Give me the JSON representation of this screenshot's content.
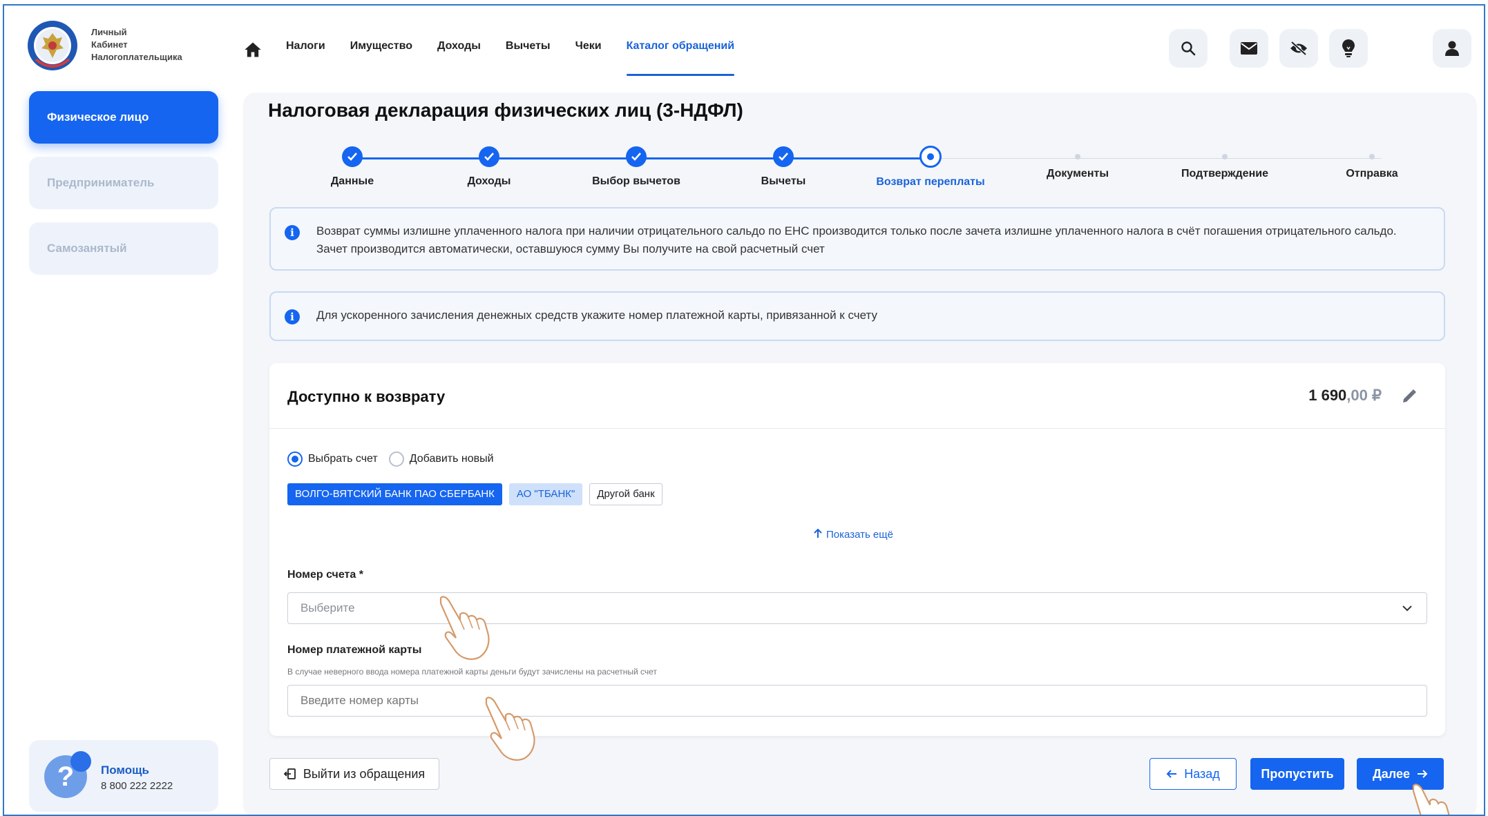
{
  "logo": {
    "line1": "Личный",
    "line2": "Кабинет",
    "line3": "Налогоплательщика"
  },
  "nav": {
    "items": [
      "Налоги",
      "Имущество",
      "Доходы",
      "Вычеты",
      "Чеки",
      "Каталог обращений"
    ],
    "active": "Каталог обращений"
  },
  "header_icons": [
    "search-icon",
    "mail-icon",
    "eye-off-icon",
    "lightbulb-icon",
    "user-icon"
  ],
  "sidebar": {
    "items": [
      "Физическое лицо",
      "Предприниматель",
      "Самозанятый"
    ],
    "active": "Физическое лицо",
    "help_title": "Помощь",
    "help_phone": "8 800 222 2222"
  },
  "page_title": "Налоговая декларация физических лиц (3-НДФЛ)",
  "stepper": {
    "steps": [
      "Данные",
      "Доходы",
      "Выбор вычетов",
      "Вычеты",
      "Возврат переплаты",
      "Документы",
      "Подтверждение",
      "Отправка"
    ],
    "current": "Возврат переплаты"
  },
  "info": {
    "notice1": "Возврат суммы излишне уплаченного налога при наличии отрицательного сальдо по ЕНС производится только после зачета излишне уплаченного налога в счёт погашения отрицательного сальдо. Зачет производится автоматически, оставшуюся сумму Вы получите на свой расчетный счет",
    "notice2": "Для ускоренного зачисления денежных средств укажите номер платежной карты, привязанной к счету"
  },
  "refund": {
    "title": "Доступно к возврату",
    "amount_main": "1 690",
    "amount_decimal": ",00 ₽",
    "radio_select": "Выбрать счет",
    "radio_new": "Добавить новый",
    "selected_radio": "Выбрать счет",
    "banks": [
      "ВОЛГО-ВЯТСКИЙ БАНК ПАО СБЕРБАНК",
      "АО \"ТБАНК\"",
      "Другой банк"
    ],
    "selected_bank": "ВОЛГО-ВЯТСКИЙ БАНК ПАО СБЕРБАНК",
    "show_more": "Показать ещё",
    "account_label": "Номер счета *",
    "account_placeholder": "Выберите",
    "card_label": "Номер платежной карты",
    "card_hint": "В случае неверного ввода номера платежной карты деньги будут зачислены на расчетный счет",
    "card_placeholder": "Введите номер карты"
  },
  "footer": {
    "exit": "Выйти из обращения",
    "back": "Назад",
    "skip": "Пропустить",
    "next": "Далее"
  },
  "colors": {
    "primary": "#1565f0",
    "frame_border": "#2e78c8",
    "sidebar_inactive_bg": "#eef3fb"
  }
}
